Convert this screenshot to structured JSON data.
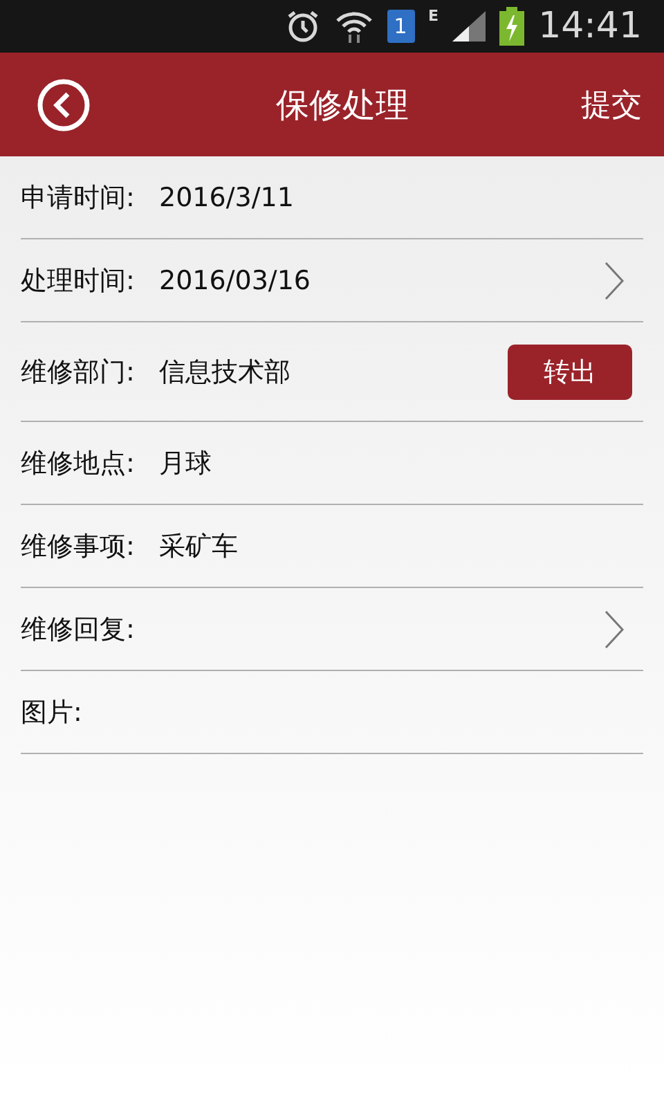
{
  "status_bar": {
    "sim_badge": "1",
    "network": "E",
    "time": "14:41"
  },
  "header": {
    "title": "保修处理",
    "action": "提交"
  },
  "rows": [
    {
      "kind": "text",
      "label": "申请时间:",
      "value": "2016/3/11"
    },
    {
      "kind": "link",
      "label": "处理时间:",
      "value": "2016/03/16"
    },
    {
      "kind": "action",
      "label": "维修部门:",
      "value": "信息技术部",
      "button": "转出"
    },
    {
      "kind": "text",
      "label": "维修地点:",
      "value": "月球"
    },
    {
      "kind": "text",
      "label": "维修事项:",
      "value": "采矿车"
    },
    {
      "kind": "link",
      "label": "维修回复:"
    },
    {
      "kind": "text",
      "label": "图片:"
    }
  ]
}
